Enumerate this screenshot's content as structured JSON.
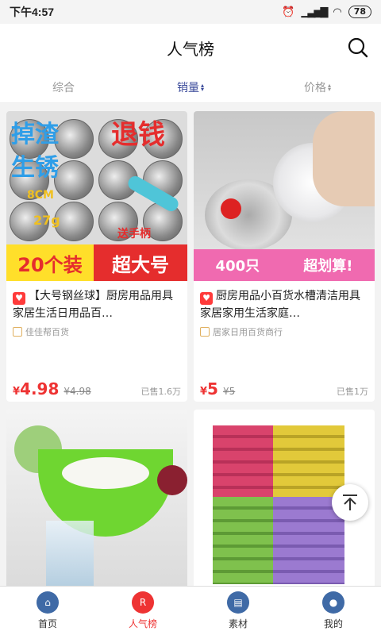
{
  "status": {
    "time": "下午4:57",
    "battery": "78"
  },
  "header": {
    "title": "人气榜"
  },
  "sort_tabs": [
    {
      "label": "综合",
      "active": false
    },
    {
      "label": "销量",
      "active": true
    },
    {
      "label": "价格",
      "active": false
    }
  ],
  "products": [
    {
      "badge": "♥",
      "title": "【大号钢丝球】厨房用品用具家居生活日用品百…",
      "shop": "佳佳帮百货",
      "currency": "¥",
      "price": "4.98",
      "original_price": "¥4.98",
      "sold": "已售1.6万",
      "image_text": {
        "a": "掉渣",
        "b": "生锈",
        "c": "退钱",
        "d": "8CM",
        "e": "27g",
        "f": "送手柄",
        "g": "20个装",
        "h": "超大号"
      }
    },
    {
      "badge": "♥",
      "title": "厨房用品小百货水槽清洁用具家居家用生活家庭…",
      "shop": "居家日用百货商行",
      "currency": "¥",
      "price": "5",
      "original_price": "¥5",
      "sold": "已售1万",
      "image_text": {
        "a": "400只",
        "b": "超划算!"
      }
    },
    {
      "title": "",
      "shop": ""
    },
    {
      "title": "",
      "shop": ""
    }
  ],
  "nav": [
    {
      "label": "首页",
      "icon": "home-icon",
      "active": false
    },
    {
      "label": "人气榜",
      "icon": "ranking-icon",
      "active": true
    },
    {
      "label": "素材",
      "icon": "material-icon",
      "active": false
    },
    {
      "label": "我的",
      "icon": "user-icon",
      "active": false
    }
  ],
  "colors": {
    "accent": "#e33333",
    "active_tab": "#3a4a9a",
    "nav_icon": "#3f6aa6"
  }
}
